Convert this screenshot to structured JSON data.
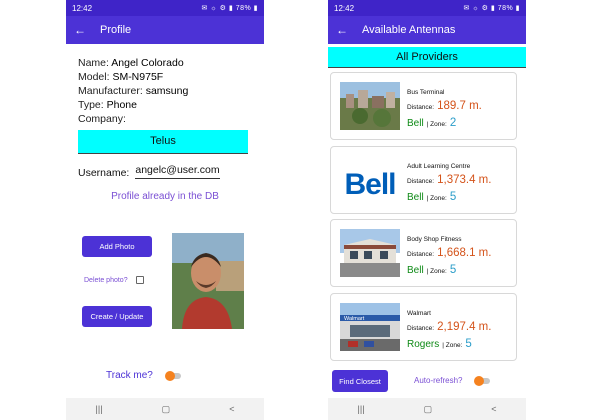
{
  "left": {
    "status": {
      "time": "12:42",
      "battery": "78%"
    },
    "appbar": {
      "title": "Profile"
    },
    "profile": {
      "name_label": "Name:",
      "name": "Angel Colorado",
      "model_label": "Model:",
      "model": "SM-N975F",
      "manufacturer_label": "Manufacturer:",
      "manufacturer": "samsung",
      "type_label": "Type:",
      "type": "Phone",
      "company_label": "Company:",
      "company": ""
    },
    "carrier": "Telus",
    "username_label": "Username:",
    "username": "angelc@user.com",
    "already_msg": "Profile already in the DB",
    "add_photo": "Add Photo",
    "delete_photo": "Delete photo?",
    "create_update": "Create / Update",
    "track_me": "Track me?"
  },
  "right": {
    "status": {
      "time": "12:42",
      "battery": "78%"
    },
    "appbar": {
      "title": "Available Antennas"
    },
    "providers": "All Providers",
    "distance_label": "Distance:",
    "zone_label": "| Zone:",
    "cards": [
      {
        "name": "Bus Terminal",
        "distance": "189.7 m.",
        "provider": "Bell",
        "zone": "2"
      },
      {
        "name": "Adult Learning Centre",
        "distance": "1,373.4 m.",
        "provider": "Bell",
        "zone": "5"
      },
      {
        "name": "Body Shop Fitness",
        "distance": "1,668.1 m.",
        "provider": "Bell",
        "zone": "5"
      },
      {
        "name": "Walmart",
        "distance": "2,197.4 m.",
        "provider": "Rogers",
        "zone": "5"
      }
    ],
    "bell_logo": "Bell",
    "walmart_logo": "Walmart",
    "find_closest": "Find Closest",
    "auto_refresh": "Auto-refresh?"
  },
  "colors": {
    "primary": "#4c32d6",
    "status": "#3f24c8",
    "cyan": "#00ffff",
    "orange": "#f5821f",
    "distance": "#d4531a",
    "provider": "#0e8a16",
    "zone": "#2b9dc9"
  }
}
